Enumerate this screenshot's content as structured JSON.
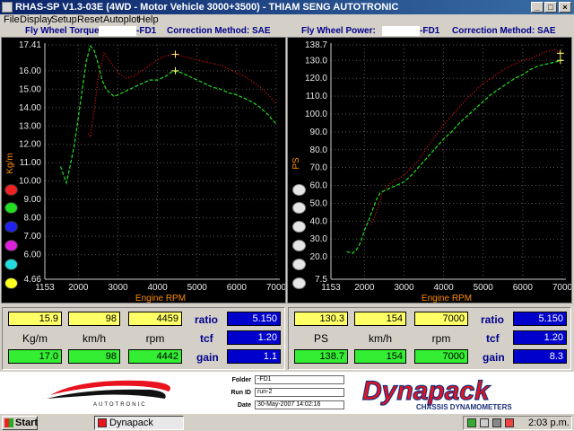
{
  "window": {
    "title": "RHAS-SP V1.3-03E  (4WD - Motor Vehicle 3000+3500)  - THIAM SENG AUTOTRONIC",
    "min_glyph": "_",
    "max_glyph": "□",
    "close_glyph": "×"
  },
  "menu": [
    "File",
    "Display",
    "Setup",
    "Reset",
    "Autoplot",
    "Help"
  ],
  "left_panel": {
    "title": "Fly Wheel Torque:",
    "run_tag": "-FD1",
    "correction": "Correction Method: SAE"
  },
  "right_panel": {
    "title": "Fly Wheel Power:",
    "run_tag": "-FD1",
    "correction": "Correction Method: SAE"
  },
  "chart_data": [
    {
      "type": "line",
      "ylabel": "Kg/m",
      "xlabel": "Engine RPM",
      "xlim": [
        1153,
        7000
      ],
      "ylim": [
        4.66,
        17.41
      ],
      "x_ticks": [
        "1153",
        "2000",
        "3000",
        "4000",
        "5000",
        "6000",
        "7000"
      ],
      "y_ticks": [
        "17.41",
        "16.00",
        "15.00",
        "14.00",
        "13.00",
        "12.00",
        "11.00",
        "10.00",
        "9.00",
        "8.00",
        "7.00",
        "6.00",
        "4.66"
      ],
      "grid": true,
      "cursor_rpm": 4450,
      "series": [
        {
          "color": "#ee1111",
          "style": "dotted",
          "x": [
            2250,
            2300,
            2400,
            2500,
            2650,
            2800,
            3000,
            3200,
            3400,
            3600,
            3800,
            4000,
            4200,
            4400,
            4600,
            4800,
            5000,
            5200,
            5400,
            5600,
            5800,
            6000,
            6200,
            6400,
            6600,
            6800,
            7000
          ],
          "y": [
            12.6,
            12.4,
            13.8,
            15.6,
            17.0,
            16.5,
            15.9,
            15.6,
            15.7,
            16.0,
            16.3,
            16.6,
            16.8,
            16.9,
            16.8,
            16.7,
            16.6,
            16.5,
            16.4,
            16.3,
            16.1,
            15.9,
            15.7,
            15.4,
            15.1,
            14.7,
            14.2
          ]
        },
        {
          "color": "#22dd22",
          "style": "dashed",
          "x": [
            1550,
            1600,
            1700,
            1800,
            1900,
            2000,
            2100,
            2200,
            2300,
            2400,
            2500,
            2600,
            2700,
            2800,
            2900,
            3000,
            3200,
            3400,
            3600,
            3800,
            4000,
            4200,
            4400,
            4600,
            4800,
            5000,
            5200,
            5400,
            5600,
            5800,
            6000,
            6200,
            6400,
            6600,
            6800,
            7000
          ],
          "y": [
            10.8,
            10.5,
            9.9,
            10.9,
            12.0,
            13.5,
            15.0,
            16.5,
            17.35,
            17.1,
            16.4,
            15.5,
            15.0,
            14.8,
            14.6,
            14.7,
            14.9,
            15.1,
            15.3,
            15.5,
            15.5,
            15.7,
            16.0,
            15.9,
            15.7,
            15.5,
            15.3,
            15.1,
            15.0,
            14.8,
            14.7,
            14.5,
            14.3,
            14.0,
            13.6,
            13.1
          ]
        }
      ]
    },
    {
      "type": "line",
      "ylabel": "PS",
      "xlabel": "Engine RPM",
      "xlim": [
        1153,
        7000
      ],
      "ylim": [
        7.5,
        138.7
      ],
      "x_ticks": [
        "1153",
        "2000",
        "3000",
        "4000",
        "5000",
        "6000",
        "7000"
      ],
      "y_ticks": [
        "138.7",
        "130.0",
        "120.0",
        "110.0",
        "100.0",
        "90.0",
        "80.0",
        "70.0",
        "60.0",
        "50.0",
        "40.0",
        "30.0",
        "20.0",
        "7.5"
      ],
      "grid": true,
      "cursor_rpm": 6950,
      "series": [
        {
          "color": "#ee1111",
          "style": "dotted",
          "x": [
            2150,
            2250,
            2350,
            2450,
            2600,
            2750,
            2900,
            3000,
            3200,
            3400,
            3600,
            3800,
            4000,
            4200,
            4400,
            4600,
            4800,
            5000,
            5200,
            5400,
            5600,
            5800,
            6000,
            6200,
            6400,
            6600,
            6800,
            7000
          ],
          "y": [
            38,
            42,
            48,
            56,
            60,
            63,
            64,
            66,
            70,
            75,
            82,
            88,
            94,
            99,
            104,
            109,
            113,
            117,
            120,
            123,
            126,
            128,
            130,
            131,
            133,
            135,
            136,
            134
          ]
        },
        {
          "color": "#22dd22",
          "style": "dashed",
          "x": [
            1550,
            1700,
            1800,
            1900,
            2000,
            2100,
            2200,
            2300,
            2400,
            2500,
            2600,
            2700,
            2800,
            2900,
            3000,
            3200,
            3400,
            3600,
            3800,
            4000,
            4200,
            4400,
            4600,
            4800,
            5000,
            5200,
            5400,
            5600,
            5800,
            6000,
            6200,
            6400,
            6600,
            6800,
            7000
          ],
          "y": [
            23,
            22,
            24,
            28,
            35,
            40,
            46,
            52,
            56,
            57,
            58,
            59,
            60,
            61,
            62,
            66,
            71,
            76,
            81,
            86,
            90,
            95,
            99,
            103,
            107,
            111,
            114,
            117,
            120,
            122,
            125,
            127,
            128,
            129,
            130
          ]
        }
      ]
    }
  ],
  "left_readouts": {
    "top": [
      "15.9",
      "98",
      "4459"
    ],
    "units": [
      "Kg/m",
      "km/h",
      "rpm"
    ],
    "bottom": [
      "17.0",
      "98",
      "4442"
    ],
    "ratio_label": "ratio",
    "ratio": "5.150",
    "tcf_label": "tcf",
    "tcf": "1.20",
    "gain_label": "gain",
    "gain": "1.1"
  },
  "right_readouts": {
    "top": [
      "130.3",
      "154",
      "7000"
    ],
    "units": [
      "PS",
      "km/h",
      "rpm"
    ],
    "bottom": [
      "138.7",
      "154",
      "7000"
    ],
    "ratio_label": "ratio",
    "ratio": "5.150",
    "tcf_label": "tcf",
    "tcf": "1.20",
    "gain_label": "gain",
    "gain": "8.3"
  },
  "left_dots": [
    "#ee2222",
    "#22dd22",
    "#2222ee",
    "#dd22dd",
    "#22dddd",
    "#ffff22"
  ],
  "footer": {
    "autotronic_logo": "AUTOTRONIC",
    "folder_label": "Folder",
    "folder": "-FD1",
    "runid_label": "Run ID",
    "runid": "run-2",
    "date_label": "Date",
    "date": "30-May-2007  14:02:16",
    "dynapack_logo": "Dynapack",
    "dynapack_tagline": "CHASSIS DYNAMOMETERS"
  },
  "taskbar": {
    "start": "Start",
    "task": "Dynapack",
    "clock": "2:03 p.m."
  }
}
